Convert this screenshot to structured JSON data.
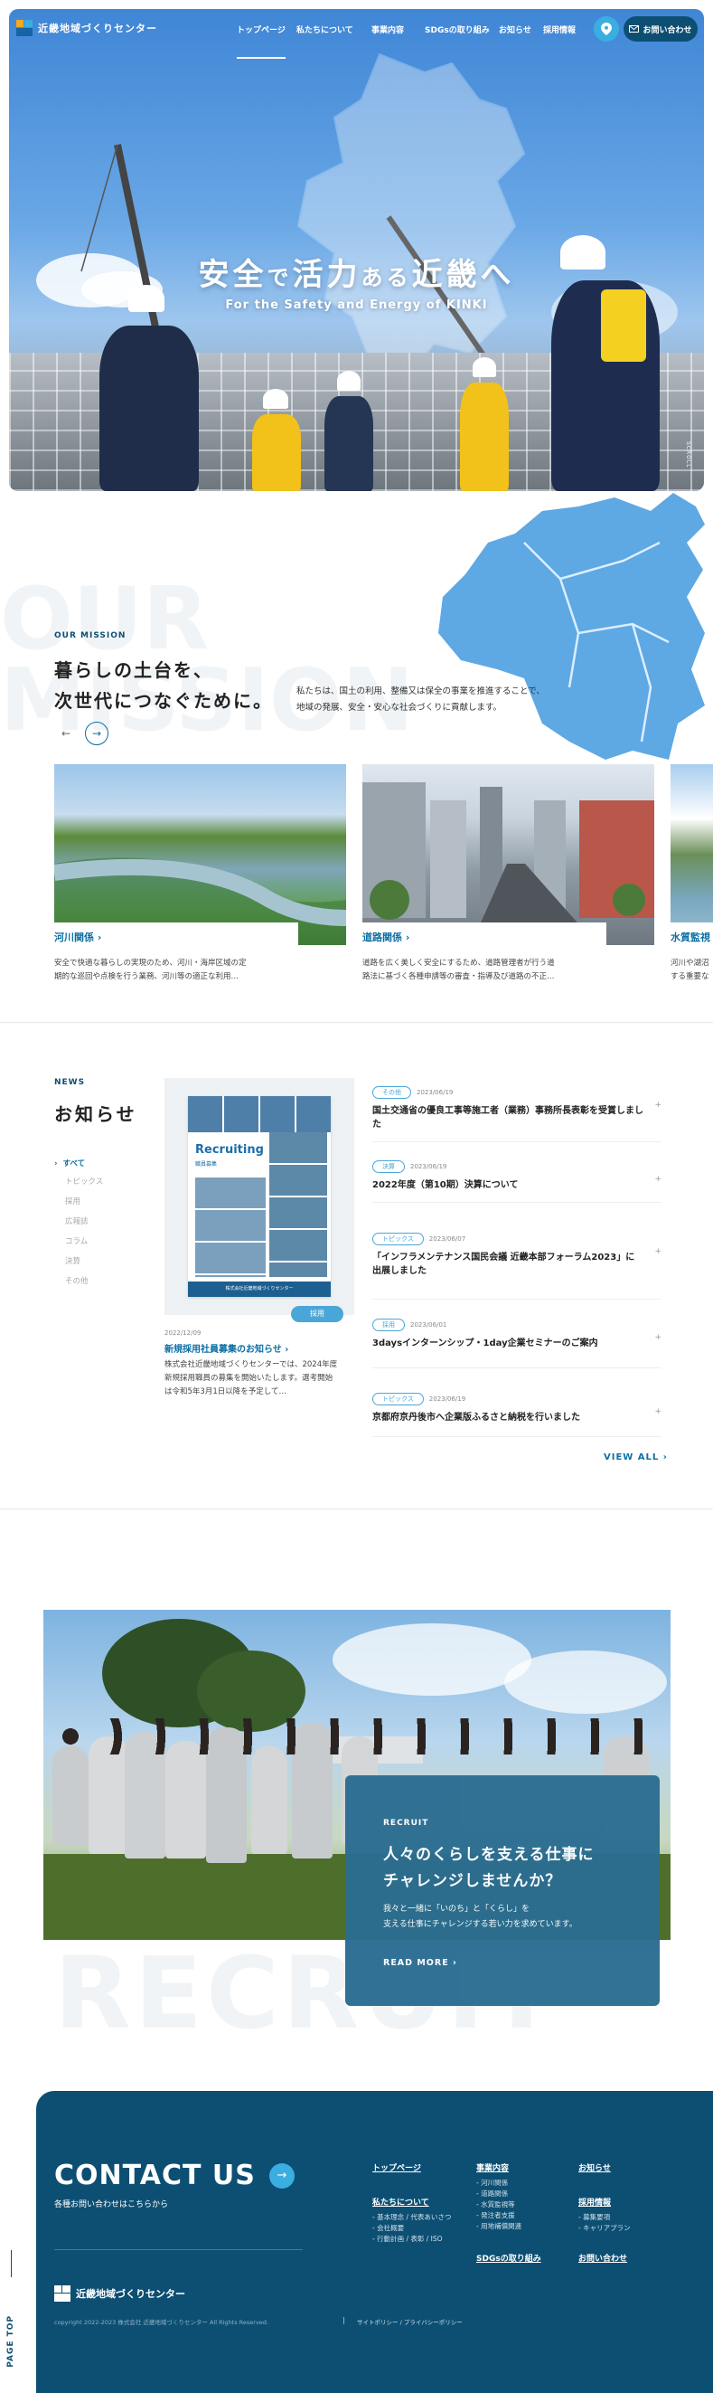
{
  "header": {
    "logo_text": "近畿地域づくりセンター",
    "nav": [
      "トップページ",
      "私たちについて",
      "事業内容",
      "SDGsの取り組み",
      "お知らせ",
      "採用情報"
    ],
    "contact_button": "お問い合わせ"
  },
  "hero": {
    "title_part1": "安全",
    "title_part2": "で",
    "title_part3": "活力",
    "title_part4": "ある",
    "title_part5": "近畿",
    "title_part6": "へ",
    "subtitle": "For the Safety and Energy of KINKI",
    "scroll_label": "SCROLL"
  },
  "mission": {
    "watermark1": "OUR",
    "watermark2": "MISSION",
    "label": "OUR MISSION",
    "title_line1": "暮らしの土台を、",
    "title_line2": "次世代につなぐために。",
    "desc_line1": "私たちは、国土の利用、整備又は保全の事業を推進することで、",
    "desc_line2": "地域の発展、安全・安心な社会づくりに貢献します。",
    "prev_arrow": "←",
    "next_arrow": "→",
    "cards": [
      {
        "title": "河川関係",
        "desc_line1": "安全で快適な暮らしの実現のため、河川・海岸区域の定",
        "desc_line2": "期的な巡回や点検を行う業務、河川等の適正な利用…"
      },
      {
        "title": "道路関係",
        "desc_line1": "道路を広く美しく安全にするため、道路管理者が行う道",
        "desc_line2": "路法に基づく各種申請等の審査・指導及び道路の不正…"
      },
      {
        "title": "水質監視",
        "desc_line1": "河川や湖沼",
        "desc_line2": "する重要な"
      }
    ]
  },
  "news": {
    "label": "NEWS",
    "title": "お知らせ",
    "filters": [
      "すべて",
      "トピックス",
      "採用",
      "広報誌",
      "コラム",
      "決算",
      "その他"
    ],
    "featured": {
      "poster_title": "Recruiting",
      "poster_sub": "職員募集",
      "poster_footer": "株式会社近畿地域づくりセンター",
      "badge": "採用",
      "date": "2022/12/09",
      "title": "新規採用社員募集のお知らせ",
      "desc_line1": "株式会社近畿地域づくりセンターでは、2024年度",
      "desc_line2": "新規採用職員の募集を開始いたします。選考開始",
      "desc_line3": "は令和5年3月1日以降を予定して…"
    },
    "items": [
      {
        "tag": "その他",
        "date": "2023/06/19",
        "text": "国土交通省の優良工事等施工者（業務）事務所長表彰を受賞しました"
      },
      {
        "tag": "決算",
        "date": "2023/06/19",
        "text": "2022年度（第10期）決算について"
      },
      {
        "tag": "トピックス",
        "date": "2023/06/07",
        "text": "「インフラメンテナンス国民会議 近畿本部フォーラム2023」に出展しました"
      },
      {
        "tag": "採用",
        "date": "2023/06/01",
        "text": "3daysインターンシップ・1day企業セミナーのご案内"
      },
      {
        "tag": "トピックス",
        "date": "2023/06/19",
        "text": "京都府京丹後市へ企業版ふるさと納税を行いました"
      }
    ],
    "view_all": "VIEW ALL"
  },
  "recruit": {
    "label": "RECRUIT",
    "title_line1": "人々のくらしを支える仕事に",
    "title_line2": "チャレンジしませんか？",
    "desc_line1": "我々と一緒に「いのち」と「くらし」を",
    "desc_line2": "支える仕事にチャレンジする若い力を求めています。",
    "read_more": "READ MORE",
    "watermark": "RECRUIT"
  },
  "contact": {
    "title": "CONTACT US",
    "subtitle": "各種お問い合わせはこちらから",
    "logo_text": "近畿地域づくりセンター",
    "copyright": "copyright 2022-2023 株式会社 近畿地域づくりセンター All Rights Reserved.",
    "policy": "サイトポリシー / プライバシーポリシー",
    "page_top": "PAGE TOP",
    "col1": {
      "head1": "トップページ",
      "head2": "私たちについて",
      "subs": [
        "- 基本理念 / 代表あいさつ",
        "- 会社概要",
        "- 行動計画 / 表彰 / ISO"
      ]
    },
    "col2": {
      "head1": "事業内容",
      "subs": [
        "- 河川関係",
        "- 道路関係",
        "- 水質監視等",
        "- 発注者支援",
        "- 用地補償関連"
      ],
      "head2": "SDGsの取り組み"
    },
    "col3": {
      "head1": "お知らせ",
      "head2": "採用情報",
      "subs": [
        "- 募集要項",
        "- キャリアプラン"
      ],
      "head3": "お問い合わせ"
    }
  },
  "colors": {
    "primary": "#0d4f73",
    "accent": "#3aaee0",
    "link": "#0d6fa3"
  }
}
